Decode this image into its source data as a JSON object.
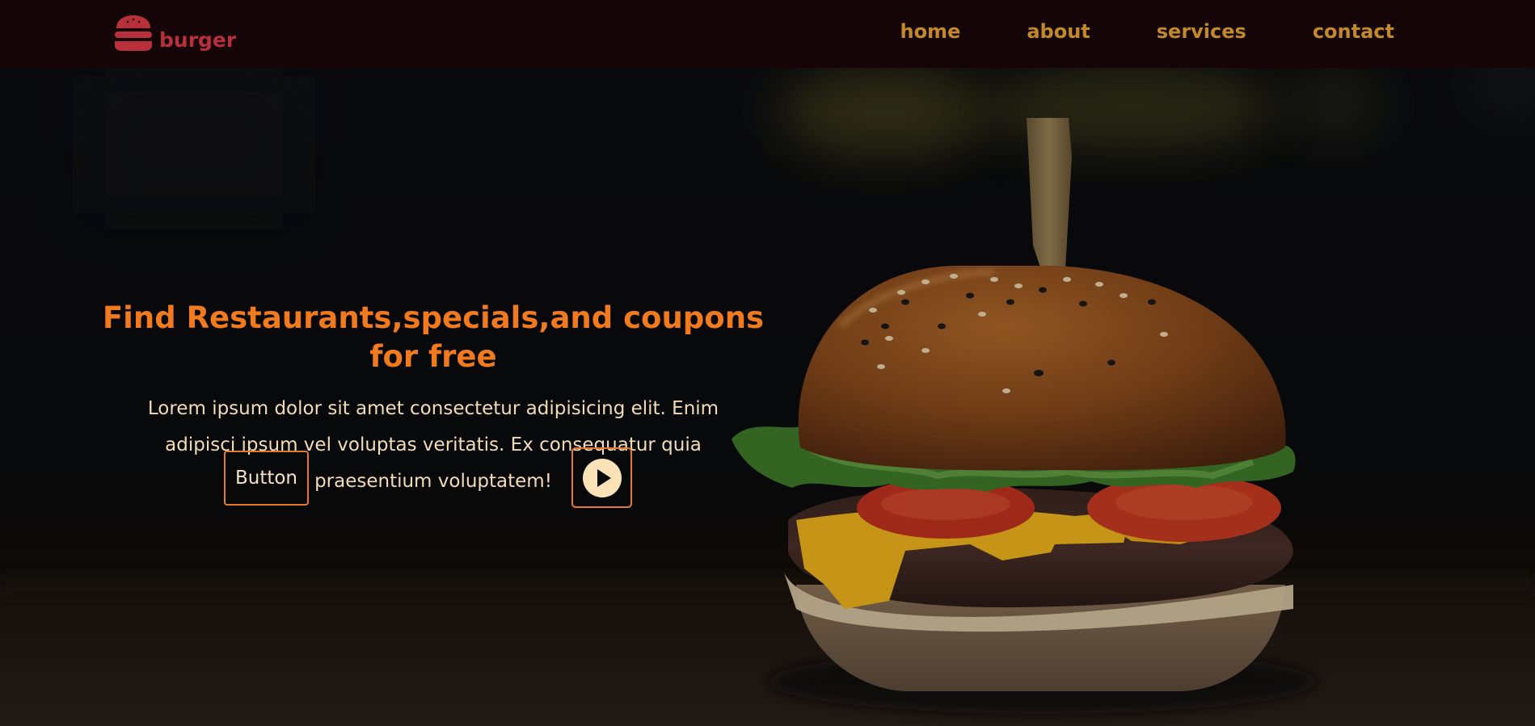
{
  "navbar": {
    "brand_text": "burger",
    "brand_icon": "burger-icon",
    "links": [
      {
        "label": "home"
      },
      {
        "label": "about"
      },
      {
        "label": "services"
      },
      {
        "label": "contact"
      }
    ]
  },
  "hero": {
    "title": "Find Restaurants,specials,and coupons for free",
    "description": "Lorem ipsum dolor sit amet consectetur adipisicing elit. Enim adipisci ipsum vel voluptas veritatis. Ex consequatur quia praesentium voluptatem!",
    "button_label": "Button",
    "play_icon": "play-icon"
  },
  "colors": {
    "navbar_bg": "#150408",
    "brand": "#b8313a",
    "nav_link": "#c2892a",
    "title": "#f07a1d",
    "text": "#f3dcb7",
    "button_border": "#e37b2b"
  }
}
